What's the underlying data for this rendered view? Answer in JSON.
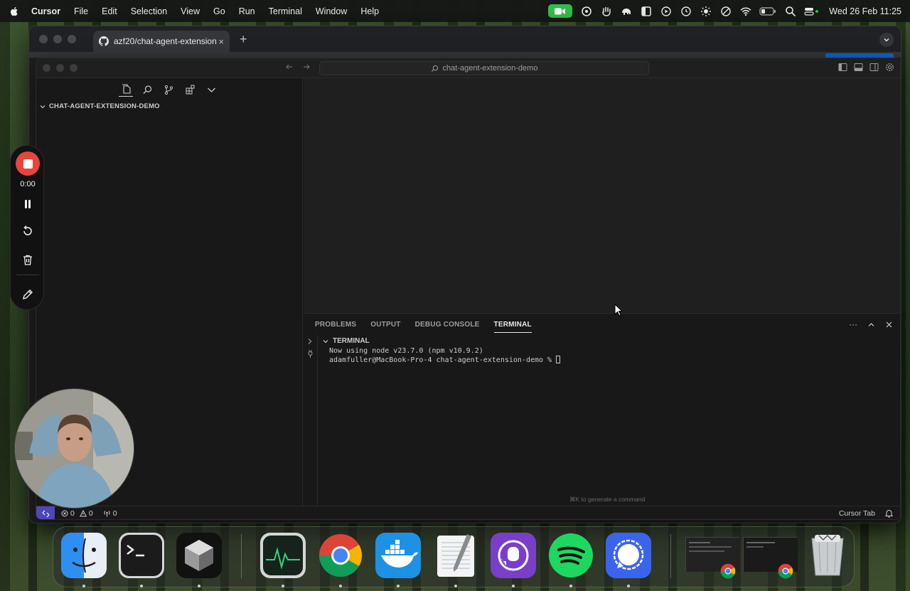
{
  "menubar": {
    "app_name": "Cursor",
    "items": [
      "File",
      "Edit",
      "Selection",
      "View",
      "Go",
      "Run",
      "Terminal",
      "Window",
      "Help"
    ],
    "clock": "Wed 26 Feb  11:25"
  },
  "browser": {
    "tab_title": "azf20/chat-agent-extension",
    "tab_close": "×",
    "new_tab": "+"
  },
  "editor": {
    "search_text": "chat-agent-extension-demo",
    "explorer_header": "CHAT-AGENT-EXTENSION-DEMO",
    "panel_tabs": [
      "PROBLEMS",
      "OUTPUT",
      "DEBUG CONSOLE",
      "TERMINAL"
    ],
    "active_panel_tab": "TERMINAL",
    "panel_more": "···",
    "terminal_section": "TERMINAL",
    "terminal_line_1": "Now using node v23.7.0 (npm v10.9.2)",
    "terminal_line_2": "adamfuller@MacBook-Pro-4 chat-agent-extension-demo % ",
    "terminal_hint": "⌘K to generate a command",
    "status": {
      "errors": "0",
      "warnings": "0",
      "ports": "0",
      "cursor_tab": "Cursor Tab"
    }
  },
  "recorder": {
    "time": "0:00"
  },
  "colors": {
    "accent_blue": "#0b66d0",
    "record_red": "#e8453c",
    "remote_purple": "#4f46b8",
    "facetime_green": "#31c24a"
  },
  "dock": {
    "apps": [
      "finder-icon",
      "terminal-icon",
      "cursor-icon",
      "activity-monitor-icon",
      "chrome-icon",
      "docker-icon",
      "textedit-icon",
      "github-desktop-icon",
      "spotify-icon",
      "signal-icon",
      "trash-icon"
    ]
  }
}
